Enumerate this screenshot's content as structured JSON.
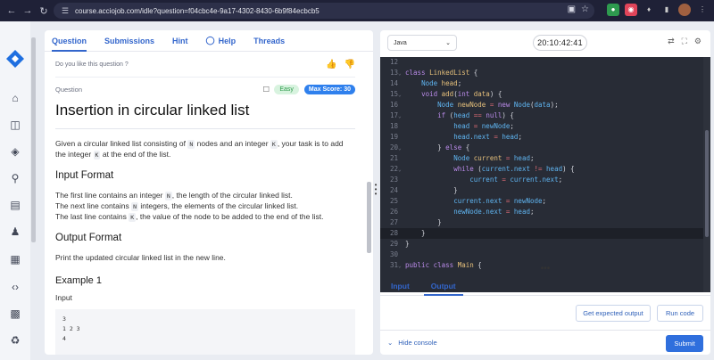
{
  "browser": {
    "url": "course.acciojob.com/idle?question=f04cbc4e-9a17-4302-8430-6b9f84ecbcb5",
    "icons": [
      "back-icon",
      "forward-icon",
      "reload-icon",
      "site-info-icon",
      "cast-icon",
      "star-icon"
    ]
  },
  "rail": {
    "icons": [
      "home-icon",
      "book-icon",
      "layers-icon",
      "trophy-icon",
      "chat-icon",
      "people-icon",
      "document-icon",
      "code-icon",
      "calendar-icon",
      "recycle-icon"
    ]
  },
  "left": {
    "tabs": [
      {
        "label": "Question"
      },
      {
        "label": "Submissions"
      },
      {
        "label": "Hint"
      },
      {
        "label": "Help"
      },
      {
        "label": "Threads"
      }
    ],
    "like_prompt": "Do you like this question ?",
    "section_label": "Question",
    "difficulty": "Easy",
    "max_score": "Max Score: 30",
    "title": "Insertion in circular linked list",
    "desc_1": "Given a circular linked list consisting of",
    "desc_n": "N",
    "desc_2": "nodes and an integer",
    "desc_k": "K",
    "desc_3": ", your task is to add the integer",
    "desc_k2": "K",
    "desc_4": "at the end of the list.",
    "input_format_title": "Input Format",
    "if_1a": "The first line contains an integer",
    "if_1n": "N",
    "if_1b": ", the length of the circular linked list.",
    "if_2a": "The next line contains",
    "if_2n": "N",
    "if_2b": "integers, the elements of the circular linked list.",
    "if_3a": "The last line contains",
    "if_3k": "K",
    "if_3b": ", the value of the node to be added to the end of the list.",
    "output_format_title": "Output Format",
    "output_format_text": "Print the updated circular linked list in the new line.",
    "example_title": "Example 1",
    "example_input_label": "Input",
    "example_input_lines": [
      "3",
      "1 2 3",
      "4"
    ]
  },
  "right": {
    "language": "Java",
    "timer": "20:10:42:41",
    "code_lines": [
      {
        "n": "12",
        "text": ""
      },
      {
        "n": "13",
        "text": "class LinkedList {"
      },
      {
        "n": "14",
        "text": "    Node head;"
      },
      {
        "n": "15",
        "text": "    void add(int data) {"
      },
      {
        "n": "16",
        "text": "        Node newNode = new Node(data);"
      },
      {
        "n": "17",
        "text": "        if (head == null) {"
      },
      {
        "n": "18",
        "text": "            head = newNode;"
      },
      {
        "n": "19",
        "text": "            head.next = head;"
      },
      {
        "n": "20",
        "text": "        } else {"
      },
      {
        "n": "21",
        "text": "            Node current = head;"
      },
      {
        "n": "22",
        "text": "            while (current.next != head) {"
      },
      {
        "n": "23",
        "text": "                current = current.next;"
      },
      {
        "n": "24",
        "text": "            }"
      },
      {
        "n": "25",
        "text": "            current.next = newNode;"
      },
      {
        "n": "26",
        "text": "            newNode.next = head;"
      },
      {
        "n": "27",
        "text": "        }"
      },
      {
        "n": "28",
        "text": "    }"
      },
      {
        "n": "29",
        "text": "}"
      },
      {
        "n": "30",
        "text": ""
      },
      {
        "n": "31",
        "text": "public class Main {"
      }
    ],
    "io_tabs": [
      {
        "label": "Input"
      },
      {
        "label": "Output"
      }
    ],
    "get_expected_output": "Get expected output",
    "run_code": "Run code",
    "hide_console": "Hide console",
    "submit": "Submit"
  }
}
